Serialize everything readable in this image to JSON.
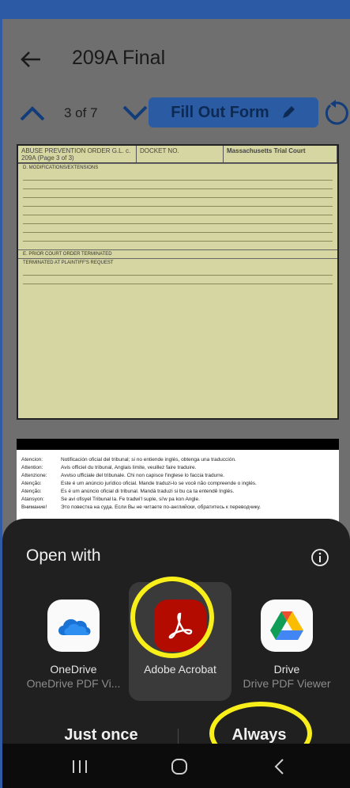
{
  "header": {
    "title": "209A Final"
  },
  "pager": {
    "current": "3 of 7",
    "fill_button": "Fill Out Form"
  },
  "document": {
    "page1_header": [
      "ABUSE PREVENTION ORDER G.L. c. 209A (Page 3 of 3)",
      "DOCKET NO.",
      "Massachusetts Trial Court"
    ],
    "page1_sections": [
      "D. MODIFICATIONS/EXTENSIONS",
      "E. PRIOR COURT ORDER TERMINATED",
      "TERMINATED AT PLAINTIFF'S REQUEST"
    ],
    "page2_rows": [
      {
        "k": "Atencion:",
        "v": "Notificación oficial del tribunal; si no entiende inglés, obtenga una traducción."
      },
      {
        "k": "Attention:",
        "v": "Avis officiel du tribunal, Anglais limite, veuillez faire traduire."
      },
      {
        "k": "Attenzione:",
        "v": "Avviso ufficiale del tribunale.  Chi non capisce l'inglese lo faccia tradurre."
      },
      {
        "k": "Atenção:",
        "v": "Este é um anúncio jurídico oficial.  Mande traduzi-lo se você não compreende o inglés."
      },
      {
        "k": "Atenção:",
        "v": "Es é um anúncio oficial di tribunal.  Mandá traduzi si bu ca ta entendê Inglés."
      },
      {
        "k": "Atansyon:",
        "v": "Se avi ofisyel Tribunal la.  Fe tradwi'l suple, si'w pa kon Angle."
      },
      {
        "k": "Внимание!",
        "v": "Это повестка на суда. Если Вы не читаете по-английски, обратитесь к переводчику."
      }
    ]
  },
  "sheet": {
    "title": "Open with",
    "apps": [
      {
        "name": "OneDrive",
        "sub": "OneDrive PDF Vi..."
      },
      {
        "name": "Adobe Acrobat",
        "sub": ""
      },
      {
        "name": "Drive",
        "sub": "Drive PDF Viewer"
      }
    ],
    "just_once": "Just once",
    "always": "Always"
  },
  "colors": {
    "status_bar": "#2d5aa4",
    "highlight": "#f8ef1a",
    "acrobat_red": "#b30b00",
    "sheet_bg": "#202020"
  }
}
